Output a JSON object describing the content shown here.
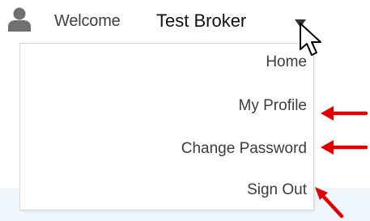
{
  "header": {
    "welcome_label": "Welcome",
    "user_name": "Test Broker",
    "user_icon": "user-silhouette-icon",
    "caret_icon": "caret-down-icon"
  },
  "menu": {
    "items": [
      {
        "label": "Home"
      },
      {
        "label": "My Profile"
      },
      {
        "label": "Change Password"
      },
      {
        "label": "Sign Out"
      }
    ]
  },
  "colors": {
    "annotation_arrow": "#e00000",
    "icon_gray": "#707070",
    "text": "#3c3c3c",
    "menu_border": "#d7d7d7",
    "bottom_band": "#eef5fb"
  }
}
